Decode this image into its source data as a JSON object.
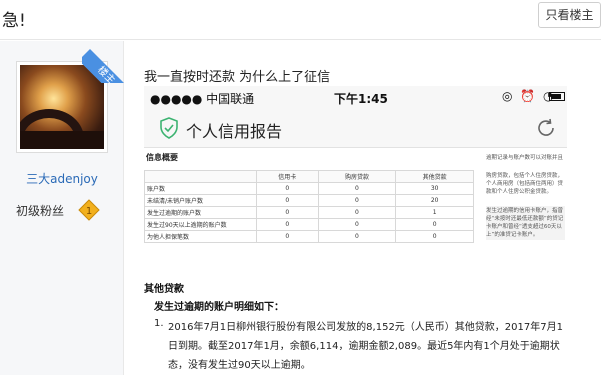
{
  "header": {
    "title": "急!",
    "only_op_label": "只看楼主"
  },
  "author": {
    "username": "三大adenjoy",
    "level": "初级粉丝",
    "level_badge": "1",
    "op_tag": "楼主"
  },
  "post": {
    "text": "我一直按时还款 为什么上了征信"
  },
  "screenshot": {
    "status": {
      "carrier": "●●●●● 中国联通",
      "time": "下午1:45",
      "icons": "◎ ⏰ ◔"
    },
    "app_title": "个人信用报告",
    "summary_title": "信息概要",
    "table": {
      "headers": [
        "",
        "信用卡",
        "购房贷款",
        "其他贷款"
      ],
      "rows": [
        {
          "label": "账户数",
          "values": [
            "0",
            "0",
            "30"
          ]
        },
        {
          "label": "未结清/未销户账户数",
          "values": [
            "0",
            "0",
            "20"
          ]
        },
        {
          "label": "发生过逾期的账户数",
          "values": [
            "0",
            "0",
            "1"
          ]
        },
        {
          "label": "发生过90天以上逾期的账户数",
          "values": [
            "0",
            "0",
            "0"
          ]
        },
        {
          "label": "为他人担保笔数",
          "values": [
            "0",
            "0",
            "0"
          ]
        }
      ]
    },
    "notes": [
      "逾期记录与账户数可以对账并且",
      "购房贷款，包括个人住房贷款，个人商用房（包括商住两用）贷款和个人住房公积金贷款。",
      "发生过逾期的信用卡账户，指曾经“未按时还最低还款额”的贷记卡账户和曾经“透支超过60天以上”的准贷记卡账户。"
    ],
    "other_loans_title": "其他贷款",
    "overdue_title": "发生过逾期的账户明细如下：",
    "item_number": "1.",
    "item_text": "2016年7月1日柳州银行股份有限公司发放的8,152元（人民币）其他贷款，2017年7月1日到期。截至2017年1月，余额6,114，逾期金额2,089。最近5年内有1个月处于逾期状态，没有发生过90天以上逾期。"
  },
  "colors": {
    "accent_blue": "#4a90e2",
    "username_blue": "#2a6ab7",
    "shield_green": "#3cb371",
    "badge_gold": "#f2b01e"
  }
}
